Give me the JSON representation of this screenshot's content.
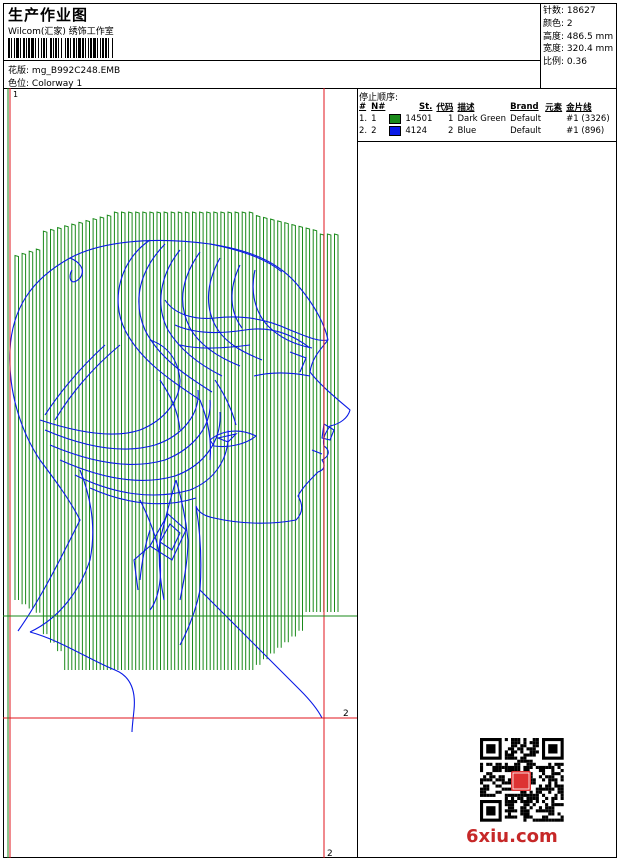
{
  "header": {
    "title": "生产作业图",
    "company": "Wilcom(汇家) 绣饰工作室",
    "pattern_label": "花版:",
    "pattern_value": "mg_B992C248.EMB",
    "color_label": "色位:",
    "color_value": "Colorway 1"
  },
  "stats": [
    {
      "label": "针数:",
      "value": "18627"
    },
    {
      "label": "颜色:",
      "value": "2"
    },
    {
      "label": "高度:",
      "value": "486.5 mm"
    },
    {
      "label": "宽度:",
      "value": "320.4 mm"
    },
    {
      "label": "比例:",
      "value": "0.36"
    }
  ],
  "stop_sequence": {
    "title": "停止顺序:",
    "columns": [
      "#",
      "N#",
      "St.",
      "代码",
      "描述",
      "Brand",
      "元素",
      "金片线"
    ],
    "rows": [
      {
        "num": "1.",
        "n": "1",
        "swatch": "#1a8a1a",
        "st": "14501",
        "code": "1",
        "desc": "Dark Green",
        "brand": "Default",
        "elem": "#1 (3326)"
      },
      {
        "num": "2.",
        "n": "2",
        "swatch": "#0a1ae6",
        "st": "4124",
        "code": "2",
        "desc": "Blue",
        "brand": "Default",
        "elem": "#1 (896)"
      }
    ]
  },
  "design": {
    "marker_1": "1",
    "marker_2": "2",
    "marker_2b": "2",
    "green": "#1a8a1a",
    "blue": "#0a1ae6",
    "red": "#e0141e"
  },
  "qr_icon": "qr-code-icon",
  "seal_text": "我印",
  "watermark": {
    "part1": "6xiu",
    "part2": ".com"
  }
}
